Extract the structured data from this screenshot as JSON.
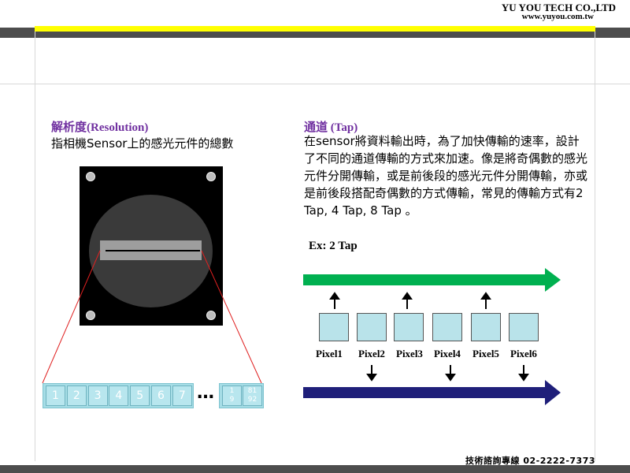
{
  "header": {
    "company_name": "YU YOU TECH CO.,LTD",
    "company_url": "www.yuyou.com.tw"
  },
  "resolution": {
    "title": "解析度(Resolution)",
    "description": "指相機Sensor上的感光元件的總數",
    "pixel_cells": [
      "1",
      "2",
      "3",
      "4",
      "5",
      "6",
      "7"
    ],
    "ellipsis": "…",
    "last_cells": [
      {
        "top": "1",
        "bottom": "9"
      },
      {
        "top": "81",
        "bottom": "92"
      }
    ]
  },
  "tap": {
    "title": "通道 (Tap)",
    "description": "在sensor將資料輸出時，為了加快傳輸的速率，設計了不同的通道傳輸的方式來加速。像是將奇偶數的感光元件分開傳輸，或是前後段的感光元件分開傳輸，亦或是前後段搭配奇偶數的方式傳輸，常見的傳輸方式有2 Tap, 4 Tap, 8 Tap 。",
    "example_label": "Ex: 2 Tap",
    "pixels": [
      "Pixel1",
      "Pixel2",
      "Pixel3",
      "Pixel4",
      "Pixel5",
      "Pixel6"
    ]
  },
  "footer": {
    "hotline": "技術諮詢專線 02-2222-7373"
  },
  "colors": {
    "accent_yellow": "#ffff00",
    "bar_gray": "#4d4d4d",
    "title_purple": "#7030a0",
    "arrow_green": "#00b050",
    "arrow_navy": "#1f1f7a",
    "cell_blue": "#b9e3ea"
  }
}
